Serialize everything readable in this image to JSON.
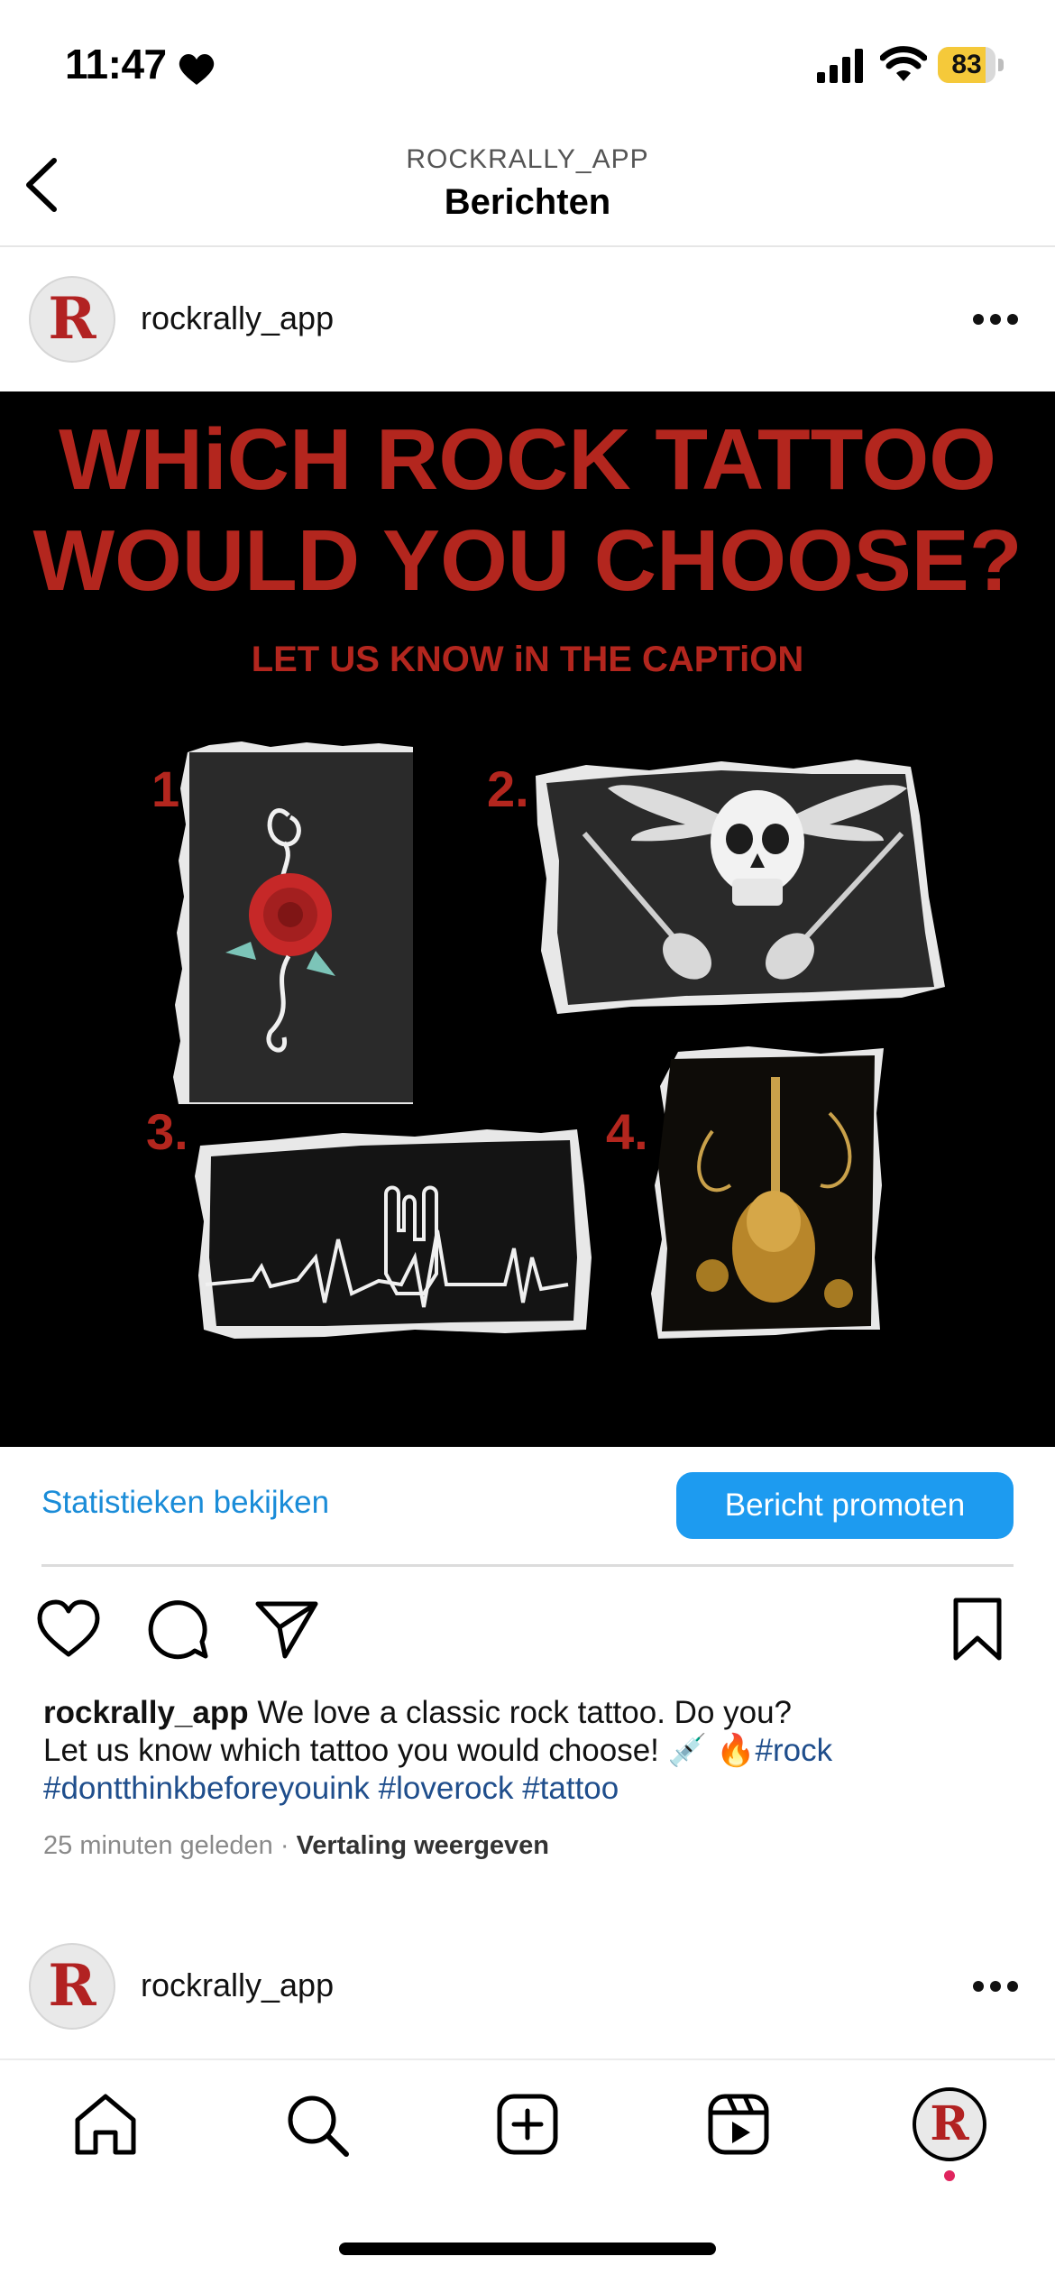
{
  "status": {
    "time": "11:47",
    "battery": "83",
    "battery_level": 0.83
  },
  "header": {
    "subtitle": "ROCKRALLY_APP",
    "title": "Berichten"
  },
  "post": {
    "username": "rockrally_app",
    "avatar_letter": "R",
    "image": {
      "headline_line1": "WHiCH ROCK TATTOO",
      "headline_line2": "WOULD YOU CHOOSE?",
      "subline": "LET US KNOW iN THE CAPTiON",
      "options": [
        "1.",
        "2.",
        "3.",
        "4."
      ],
      "colors": {
        "background": "#000000",
        "accent": "#b3261e"
      }
    },
    "actions": {
      "stats_label": "Statistieken bekijken",
      "promote_label": "Bericht promoten"
    },
    "caption": {
      "username": "rockrally_app",
      "text_line1": " We love a classic rock tattoo. Do you?",
      "text_line2": "Let us know which tattoo you would choose! 💉 🔥",
      "hashtags": [
        "#rock",
        "#dontthinkbeforeyouink",
        "#loverock",
        "#tattoo"
      ]
    },
    "meta": {
      "time_ago": "25 minuten geleden",
      "separator": "·",
      "translate": "Vertaling weergeven"
    }
  },
  "next_post": {
    "username": "rockrally_app",
    "avatar_letter": "R"
  },
  "colors": {
    "link": "#1a8cd8",
    "button": "#1d9bf0",
    "hashtag": "#1f4e8c"
  }
}
